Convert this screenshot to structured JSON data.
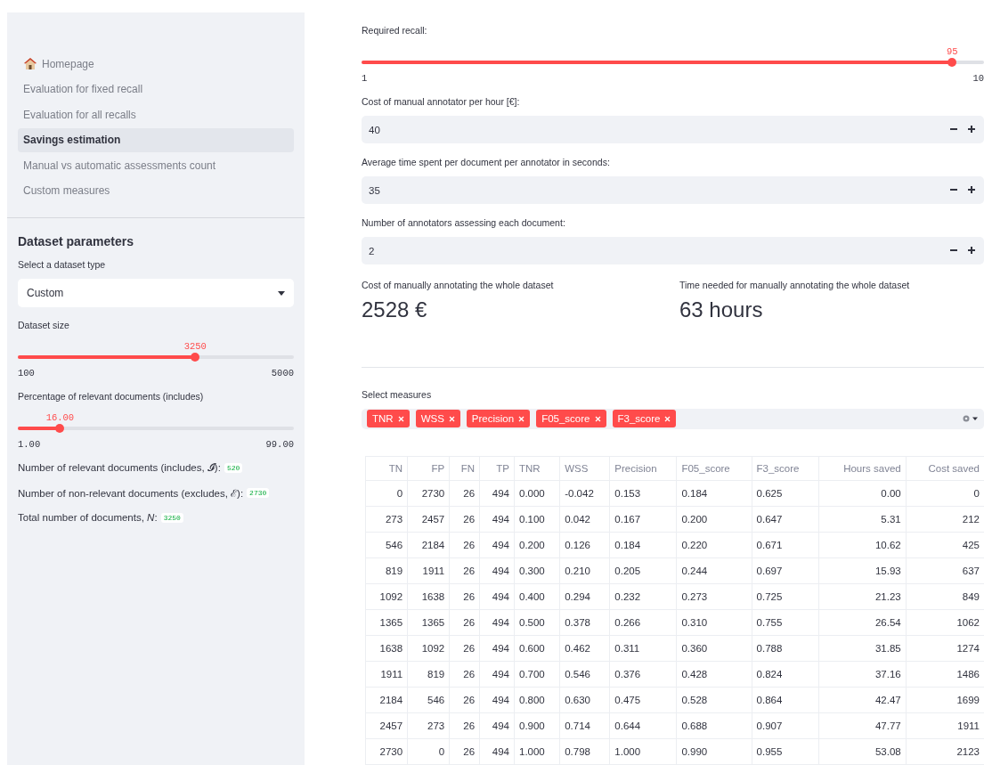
{
  "sidebar": {
    "nav": [
      {
        "label": "Homepage",
        "kind": "home",
        "selected": false
      },
      {
        "label": "Evaluation for fixed recall",
        "kind": "page",
        "selected": false
      },
      {
        "label": "Evaluation for all recalls",
        "kind": "page",
        "selected": false
      },
      {
        "label": "Savings estimation",
        "kind": "page",
        "selected": true
      },
      {
        "label": "Manual vs automatic assessments count",
        "kind": "page",
        "selected": false
      },
      {
        "label": "Custom measures",
        "kind": "page",
        "selected": false
      }
    ],
    "title": "Dataset parameters",
    "select": {
      "label": "Select a dataset type",
      "value": "Custom"
    },
    "sliders": [
      {
        "label": "Dataset size",
        "value": "3250",
        "min": "100",
        "max": "5000",
        "level": 0.643
      },
      {
        "label": "Percentage of relevant documents (includes)",
        "value": "16.00",
        "min": "1.00",
        "max": "99.00",
        "level": 0.153
      }
    ],
    "stats": [
      {
        "label": "Number of relevant documents (includes, 𝓘):",
        "value": "520"
      },
      {
        "label": "Number of non-relevant documents (excludes, ℰ):",
        "value": "2730"
      },
      {
        "label": "Total number of documents, *N*:",
        "value": "3250"
      }
    ]
  },
  "main": {
    "recall": {
      "label": "Required recall:",
      "value": "95",
      "min": "1",
      "max": "10",
      "level": 0.949
    },
    "number_inputs": [
      {
        "label": "Cost of manual annotator per hour [€]:",
        "value": "40"
      },
      {
        "label": "Average time spent per document per annotator in seconds:",
        "value": "35"
      },
      {
        "label": "Number of annotators assessing each document:",
        "value": "2"
      }
    ],
    "metrics": [
      {
        "label": "Cost of manually annotating the whole dataset",
        "value": "2528 €"
      },
      {
        "label": "Time needed for manually annotating the whole dataset",
        "value": "63 hours"
      }
    ],
    "measures": {
      "label": "Select measures",
      "tags": [
        "TNR",
        "WSS",
        "Precision",
        "F05_score",
        "F3_score"
      ]
    },
    "table": {
      "columns": [
        "TN",
        "FP",
        "FN",
        "TP",
        "TNR",
        "WSS",
        "Precision",
        "F05_score",
        "F3_score",
        "Hours saved",
        "Cost saved"
      ],
      "rows": [
        [
          "0",
          "2730",
          "26",
          "494",
          "0.000",
          "-0.042",
          "0.153",
          "0.184",
          "0.625",
          "0.00",
          "0"
        ],
        [
          "273",
          "2457",
          "26",
          "494",
          "0.100",
          "0.042",
          "0.167",
          "0.200",
          "0.647",
          "5.31",
          "212"
        ],
        [
          "546",
          "2184",
          "26",
          "494",
          "0.200",
          "0.126",
          "0.184",
          "0.220",
          "0.671",
          "10.62",
          "425"
        ],
        [
          "819",
          "1911",
          "26",
          "494",
          "0.300",
          "0.210",
          "0.205",
          "0.244",
          "0.697",
          "15.93",
          "637"
        ],
        [
          "1092",
          "1638",
          "26",
          "494",
          "0.400",
          "0.294",
          "0.232",
          "0.273",
          "0.725",
          "21.23",
          "849"
        ],
        [
          "1365",
          "1365",
          "26",
          "494",
          "0.500",
          "0.378",
          "0.266",
          "0.310",
          "0.755",
          "26.54",
          "1062"
        ],
        [
          "1638",
          "1092",
          "26",
          "494",
          "0.600",
          "0.462",
          "0.311",
          "0.360",
          "0.788",
          "31.85",
          "1274"
        ],
        [
          "1911",
          "819",
          "26",
          "494",
          "0.700",
          "0.546",
          "0.376",
          "0.428",
          "0.824",
          "37.16",
          "1486"
        ],
        [
          "2184",
          "546",
          "26",
          "494",
          "0.800",
          "0.630",
          "0.475",
          "0.528",
          "0.864",
          "42.47",
          "1699"
        ],
        [
          "2457",
          "273",
          "26",
          "494",
          "0.900",
          "0.714",
          "0.644",
          "0.688",
          "0.907",
          "47.77",
          "1911"
        ],
        [
          "2730",
          "0",
          "26",
          "494",
          "1.000",
          "0.798",
          "1.000",
          "0.990",
          "0.955",
          "53.08",
          "2123"
        ]
      ]
    }
  }
}
